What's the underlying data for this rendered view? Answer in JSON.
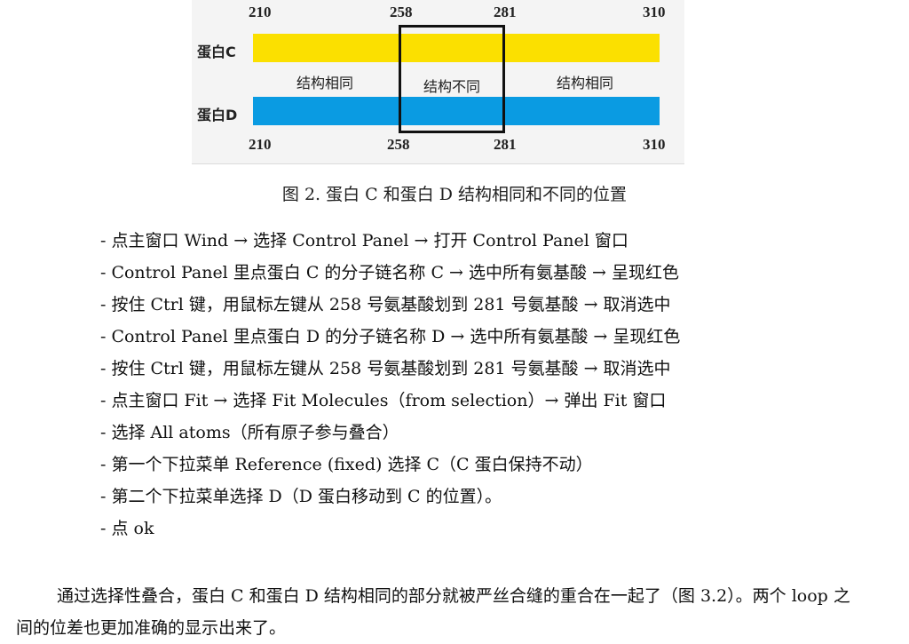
{
  "figure": {
    "top_ticks": [
      "210",
      "258",
      "281",
      "310"
    ],
    "bottom_ticks": [
      "210",
      "258",
      "281",
      "310"
    ],
    "protein_c_label": "蛋白C",
    "protein_d_label": "蛋白D",
    "region_labels": [
      "结构相同",
      "结构不同",
      "结构相同"
    ],
    "colors": {
      "protein_c": "#fbe000",
      "protein_d": "#0a9be2",
      "highlight_box": "#111111"
    },
    "caption": "图 2. 蛋白 C 和蛋白 D 结构相同和不同的位置"
  },
  "steps": [
    "- 点主窗口 Wind → 选择 Control Panel → 打开 Control Panel 窗口",
    "- Control Panel 里点蛋白 C 的分子链名称 C → 选中所有氨基酸 → 呈现红色",
    "- 按住 Ctrl 键，用鼠标左键从 258 号氨基酸划到 281 号氨基酸 → 取消选中",
    "- Control Panel 里点蛋白 D 的分子链名称 D → 选中所有氨基酸 → 呈现红色",
    "- 按住 Ctrl 键，用鼠标左键从 258 号氨基酸划到 281 号氨基酸 → 取消选中",
    "- 点主窗口 Fit → 选择 Fit Molecules（from selection）→ 弹出 Fit 窗口",
    "- 选择 All atoms（所有原子参与叠合）",
    "- 第一个下拉菜单 Reference (fixed) 选择 C（C 蛋白保持不动）",
    "- 第二个下拉菜单选择 D（D 蛋白移动到 C 的位置）。",
    "- 点 ok"
  ],
  "paragraph": "通过选择性叠合，蛋白 C 和蛋白 D 结构相同的部分就被严丝合缝的重合在一起了（图 3.2）。两个 loop 之间的位差也更加准确的显示出来了。"
}
